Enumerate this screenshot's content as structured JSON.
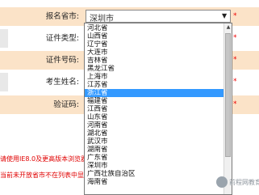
{
  "form": {
    "rows": [
      {
        "label": "报名省市:"
      },
      {
        "label": "证件类型:"
      },
      {
        "label": "证件号码:"
      },
      {
        "label": "考生姓名:"
      },
      {
        "label": "验证码:"
      }
    ],
    "required_mark": "*"
  },
  "province_select": {
    "value": "深圳市",
    "options": [
      "河北省",
      "山西省",
      "辽宁省",
      "大连市",
      "吉林省",
      "黑龙江省",
      "上海市",
      "江苏省",
      "浙江省",
      "福建省",
      "江西省",
      "山东省",
      "河南省",
      "湖北省",
      "武汉市",
      "湖南省",
      "广东省",
      "深圳市",
      "广西壮族自治区",
      "海南省"
    ],
    "selected_option": "浙江省"
  },
  "notices": [
    "请使用IE8.0及更高版本浏览器",
    "当前未开放省市不在列表中显示"
  ],
  "watermark": "前程网教育"
}
